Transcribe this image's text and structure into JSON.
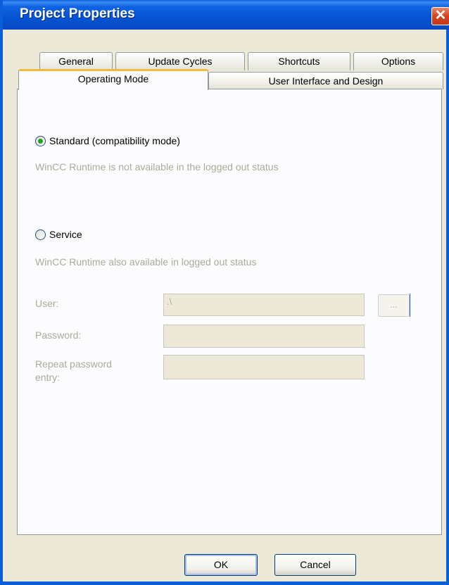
{
  "window": {
    "title": "Project Properties"
  },
  "tabs_back": [
    "General",
    "Update Cycles",
    "Shortcuts",
    "Options"
  ],
  "tabs_front": [
    "Operating Mode",
    "User Interface and Design"
  ],
  "active_tab": "Operating Mode",
  "mode": {
    "standard_label": "Standard  (compatibility mode)",
    "standard_desc": "WinCC Runtime is not available in the logged out status",
    "standard_selected": true,
    "service_label": "Service",
    "service_desc": "WinCC Runtime also available in logged out status",
    "service_selected": false
  },
  "credentials": {
    "user_label": "User:",
    "user_value": ".\\",
    "browse_label": "...",
    "password_label": "Password:",
    "repeat_label_1": "Repeat password",
    "repeat_label_2": "entry:"
  },
  "buttons": {
    "ok": "OK",
    "cancel": "Cancel"
  },
  "colors": {
    "title_bar": "#0553d4",
    "dialog_bg": "#ece9d8",
    "active_tab_accent": "#f7b83c",
    "radio_selected": "#21a121",
    "disabled_text": "#acaa99"
  }
}
